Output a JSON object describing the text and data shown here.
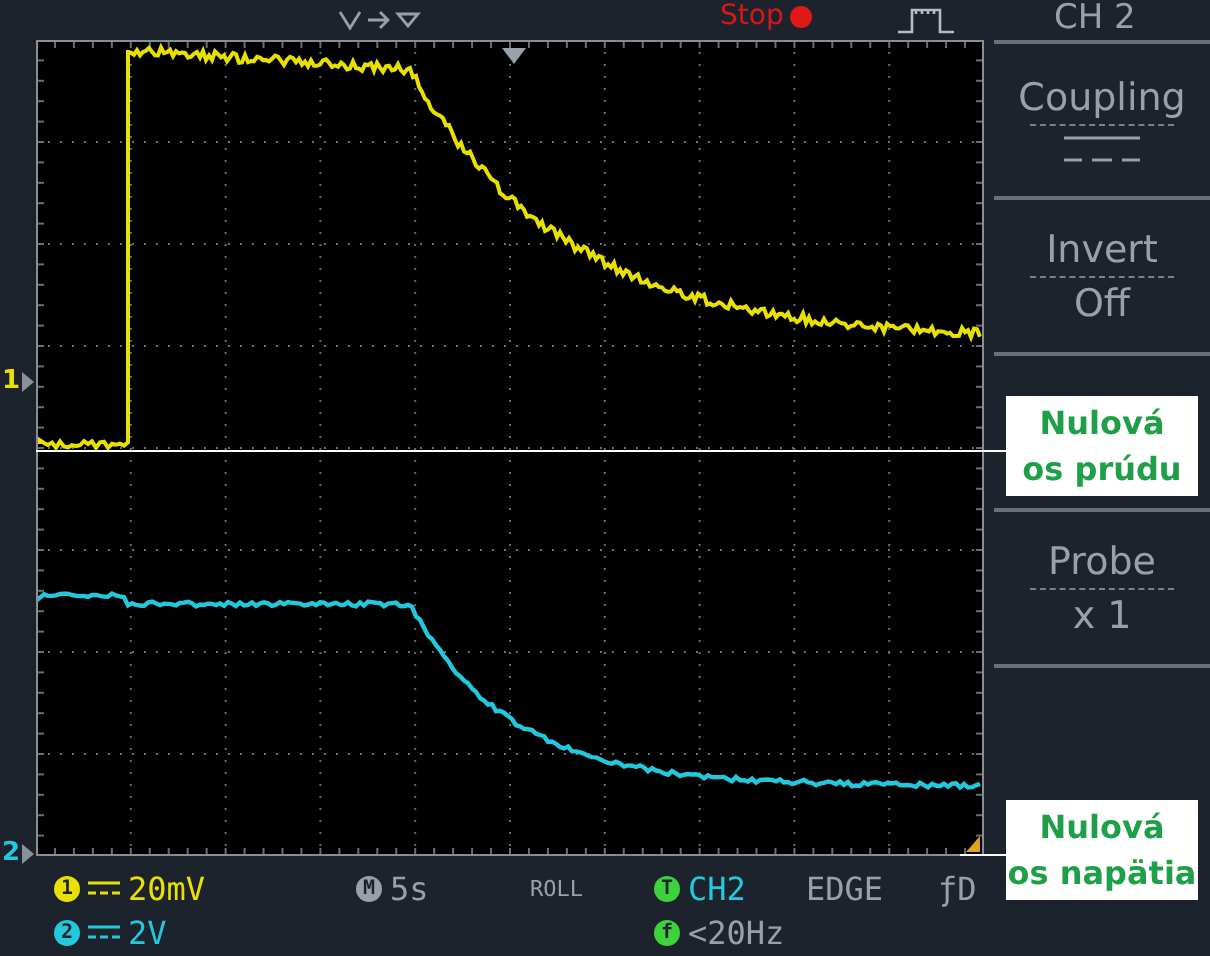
{
  "top_bar": {
    "run_state": "Stop",
    "channel": "CH 2"
  },
  "channel_markers": [
    {
      "label": "1",
      "color": "#e8e000"
    },
    {
      "label": "2",
      "color": "#22c8dc"
    }
  ],
  "menu": [
    {
      "kind": "icon",
      "title": "Coupling"
    },
    {
      "kind": "text",
      "title": "Invert",
      "value": "Off"
    },
    {
      "kind": "text",
      "title": "Probe",
      "value": "x 1"
    }
  ],
  "notes": [
    {
      "text": "Nulová\nos prúdu"
    },
    {
      "text": "Nulová\nos napätia"
    }
  ],
  "status_bar": {
    "channels": [
      {
        "badge": "1",
        "scale": "20mV",
        "color": "#e8e000"
      },
      {
        "badge": "2",
        "scale": "2V",
        "color": "#22c8dc"
      }
    ],
    "timebase": {
      "badge": "M",
      "value": "5s"
    },
    "mode": "ROLL",
    "trigger": {
      "badge": "T",
      "source": "CH2",
      "type": "EDGE",
      "slope": "ƒD"
    },
    "filter": {
      "badge": "f",
      "value": "<20Hz"
    }
  }
}
